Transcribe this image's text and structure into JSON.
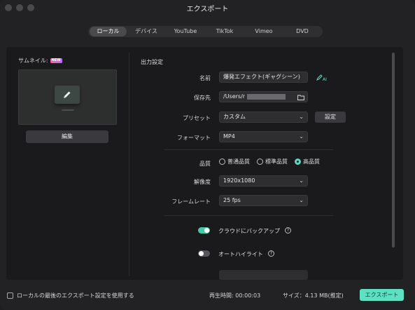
{
  "window": {
    "title": "エクスポート"
  },
  "tabs": [
    {
      "label": "ローカル",
      "active": true
    },
    {
      "label": "デバイス",
      "active": false
    },
    {
      "label": "YouTube",
      "active": false
    },
    {
      "label": "TikTok",
      "active": false
    },
    {
      "label": "Vimeo",
      "active": false
    },
    {
      "label": "DVD",
      "active": false
    }
  ],
  "thumbnail": {
    "label": "サムネイル:",
    "badge": "NEW",
    "edit_label": "編集"
  },
  "output": {
    "section_title": "出力設定",
    "name_label": "名前",
    "name_value": "爆発エフェクト(ギャグシーン)",
    "save_label": "保存先",
    "save_value": "/Users/r",
    "preset_label": "プリセット",
    "preset_value": "カスタム",
    "preset_button": "設定",
    "format_label": "フォーマット",
    "format_value": "MP4",
    "quality_label": "品質",
    "quality_options": [
      "普通品質",
      "標準品質",
      "高品質"
    ],
    "quality_selected": "高品質",
    "resolution_label": "解像度",
    "resolution_value": "1920x1080",
    "framerate_label": "フレームレート",
    "framerate_value": "25 fps",
    "cloud_backup_label": "クラウドにバックアップ",
    "cloud_backup_on": true,
    "auto_highlight_label": "オートハイライト",
    "auto_highlight_on": false
  },
  "footer": {
    "use_last_settings": "ローカルの最後のエクスポート設定を使用する",
    "duration": "再生時間:  00:00:03",
    "size": "サイズ：4.13 MB(推定)",
    "export_label": "エクスポート"
  },
  "colors": {
    "accent": "#5ee0c3",
    "toggle_on": "#47c9a9"
  }
}
